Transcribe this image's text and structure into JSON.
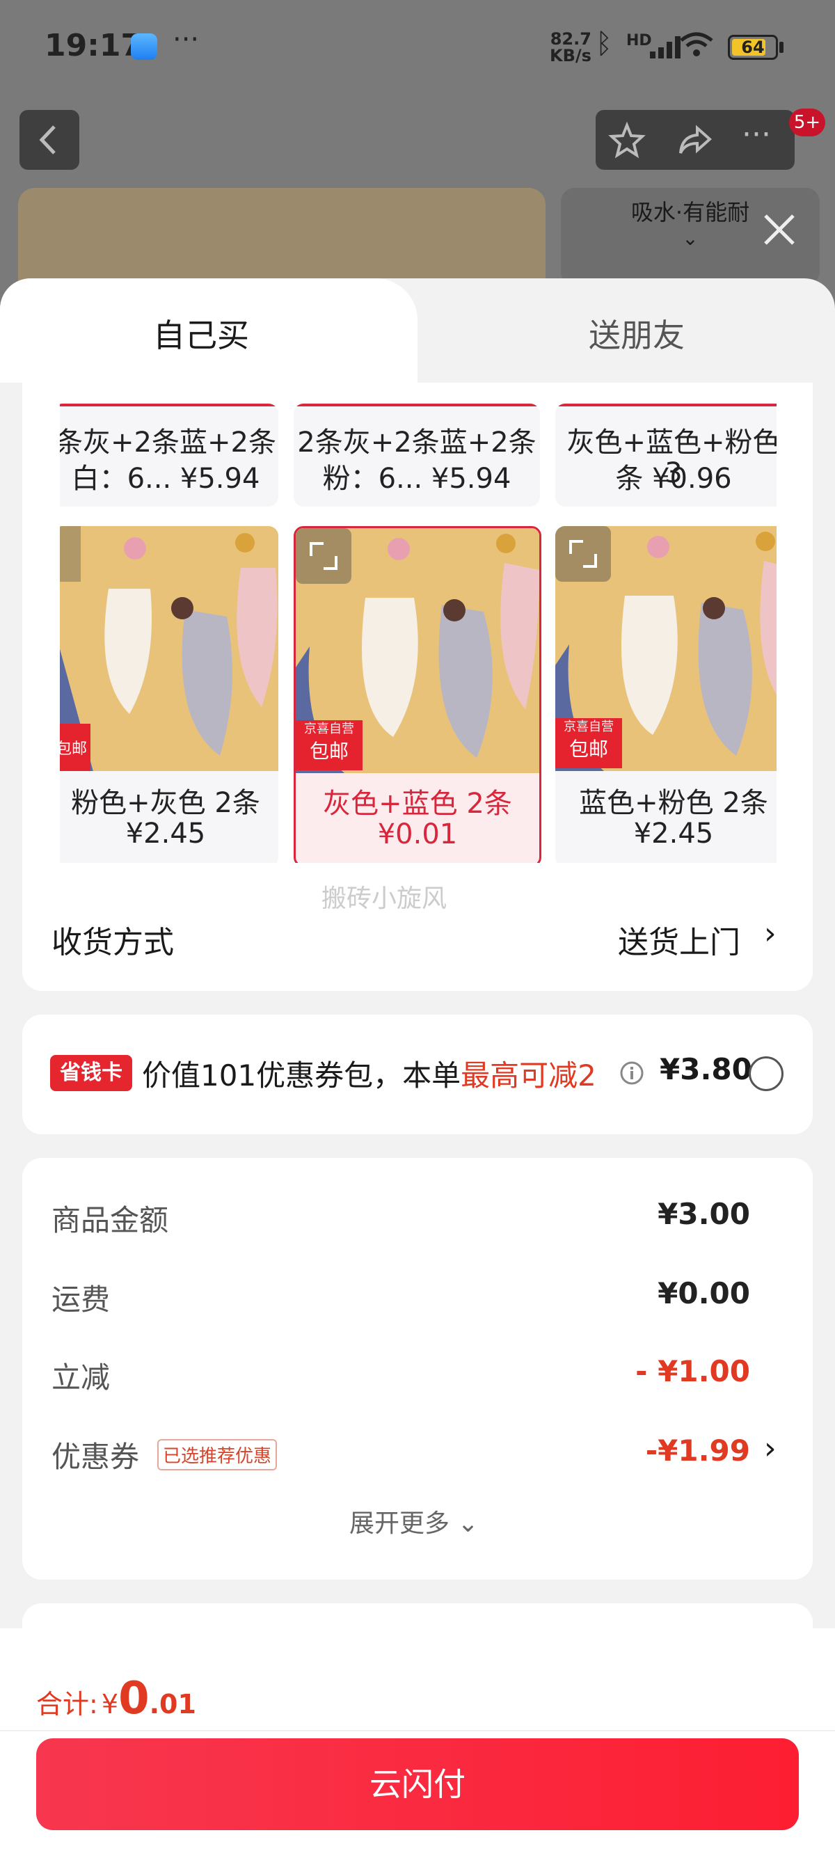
{
  "status_bar": {
    "time": "19:17",
    "dots": "···",
    "net_speed": "82.7",
    "net_unit": "KB/s",
    "hd": "HD",
    "battery": "64"
  },
  "background": {
    "product_tag": "吸水·有能耐",
    "badge": "5+"
  },
  "tabs": [
    {
      "label": "自己买",
      "active": true
    },
    {
      "label": "送朋友",
      "active": false
    }
  ],
  "variants_top": [
    {
      "line1": "条灰+2条蓝+2条",
      "line2": "白：6...  ¥5.94"
    },
    {
      "line1": "2条灰+2条蓝+2条",
      "line2": "粉：6...  ¥5.94"
    },
    {
      "line1": "灰色+蓝色+粉色 3",
      "line2": "条  ¥0.96"
    }
  ],
  "variants": [
    {
      "name": "粉色+灰色 2条",
      "price": "¥2.45",
      "tag_top": "京喜自营",
      "tag_bottom": "包邮",
      "selected": false
    },
    {
      "name": "灰色+蓝色 2条",
      "price": "¥0.01",
      "tag_top": "京喜自营",
      "tag_bottom": "包邮",
      "selected": true
    },
    {
      "name": "蓝色+粉色 2条",
      "price": "¥2.45",
      "tag_top": "京喜自营",
      "tag_bottom": "包邮",
      "selected": false
    }
  ],
  "watermark": "搬砖小旋风",
  "delivery": {
    "label": "收货方式",
    "value": "送货上门"
  },
  "promo": {
    "badge": "省钱卡",
    "text_a": "价值101优惠券包，本单",
    "text_b": "最高可减2",
    "price": "¥3.80"
  },
  "summary": {
    "rows": [
      {
        "label": "商品金额",
        "value": "¥3.00",
        "red": false
      },
      {
        "label": "运费",
        "value": "¥0.00",
        "red": false
      },
      {
        "label": "立减",
        "value": "- ¥1.00",
        "red": true
      },
      {
        "label": "优惠券",
        "value": "-¥1.99",
        "red": true,
        "tag": "已选推荐优惠"
      }
    ],
    "expand": "展开更多"
  },
  "total": {
    "label": "合计:",
    "currency": "¥",
    "int": "0",
    "dec": ".01"
  },
  "pay_button": "云闪付",
  "colors": {
    "accent": "#d8263c",
    "pay": "#fd1e32"
  }
}
